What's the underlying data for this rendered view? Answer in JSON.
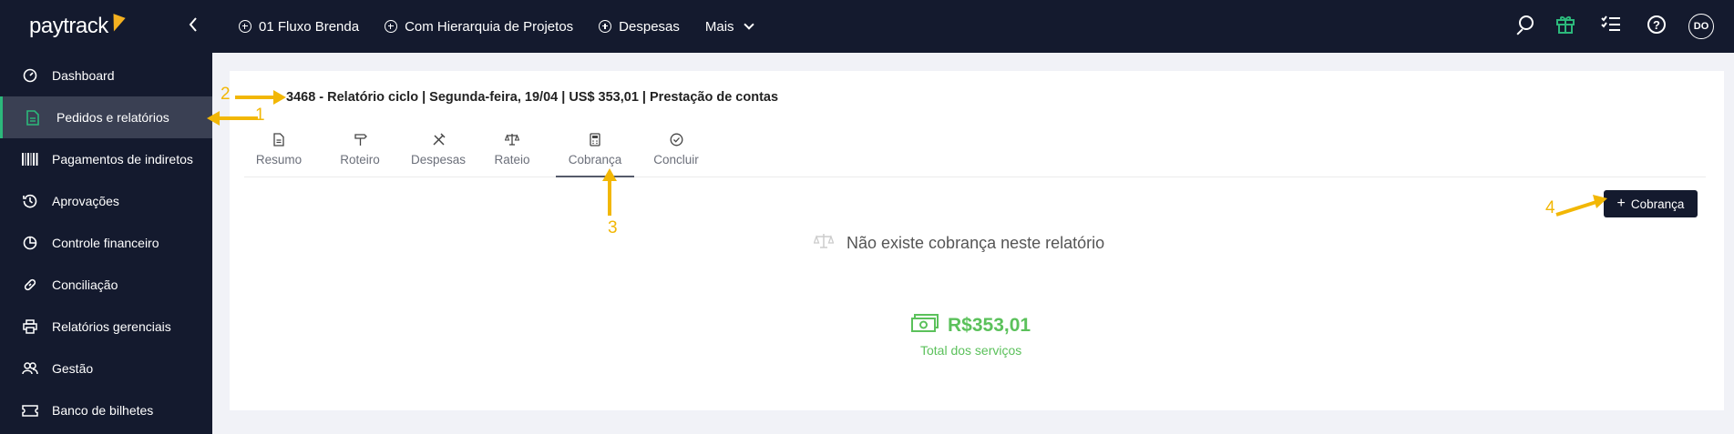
{
  "brand": {
    "logo_text": "paytrack"
  },
  "topnav": {
    "items": [
      {
        "label": "01 Fluxo Brenda"
      },
      {
        "label": "Com Hierarquia de Projetos"
      },
      {
        "label": "Despesas"
      }
    ],
    "more_label": "Mais",
    "avatar_initials": "DO"
  },
  "sidebar": {
    "items": [
      {
        "label": "Dashboard",
        "icon": "gauge-icon"
      },
      {
        "label": "Pedidos e relatórios",
        "icon": "document-icon",
        "active": true
      },
      {
        "label": "Pagamentos de indiretos",
        "icon": "barcode-icon"
      },
      {
        "label": "Aprovações",
        "icon": "history-icon"
      },
      {
        "label": "Controle financeiro",
        "icon": "pie-chart-icon"
      },
      {
        "label": "Conciliação",
        "icon": "link-icon"
      },
      {
        "label": "Relatórios gerenciais",
        "icon": "printer-icon"
      },
      {
        "label": "Gestão",
        "icon": "users-icon"
      },
      {
        "label": "Banco de bilhetes",
        "icon": "ticket-icon"
      }
    ]
  },
  "report": {
    "title": "3468 - Relatório ciclo | Segunda-feira, 19/04 | US$ 353,01 | Prestação de contas"
  },
  "tabs": [
    {
      "label": "Resumo",
      "icon": "document-icon"
    },
    {
      "label": "Roteiro",
      "icon": "signpost-icon"
    },
    {
      "label": "Despesas",
      "icon": "tools-icon"
    },
    {
      "label": "Rateio",
      "icon": "scale-icon"
    },
    {
      "label": "Cobrança",
      "icon": "calculator-icon",
      "active": true
    },
    {
      "label": "Concluir",
      "icon": "check-circle-icon"
    }
  ],
  "billing": {
    "add_button_label": "Cobrança",
    "empty_message": "Não existe cobrança neste relatório",
    "total_amount": "R$353,01",
    "total_label": "Total dos serviços"
  },
  "annotations": [
    "1",
    "2",
    "3",
    "4"
  ],
  "colors": {
    "nav_bg": "#141a2e",
    "accent_green": "#2cb87b",
    "amount_green": "#5bc15b",
    "annotation": "#f2b705"
  }
}
